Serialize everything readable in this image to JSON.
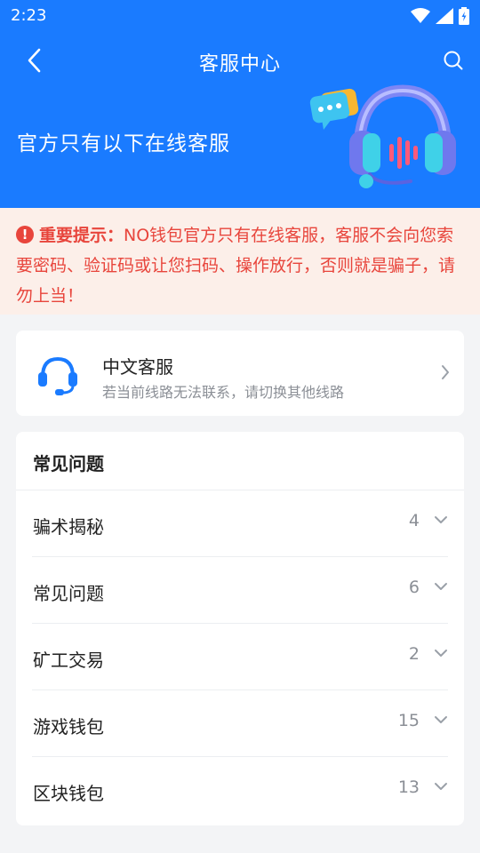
{
  "status_bar": {
    "time": "2:23"
  },
  "nav": {
    "title": "客服中心"
  },
  "hero": {
    "text": "官方只有以下在线客服"
  },
  "notice": {
    "label": "重要提示：",
    "text": "NO钱包官方只有在线客服，客服不会向您索要密码、验证码或让您扫码、操作放行，否则就是骗子，请勿上当！"
  },
  "cs": {
    "title": "中文客服",
    "subtitle": "若当前线路无法联系，请切换其他线路"
  },
  "faq": {
    "title": "常见问题",
    "items": [
      {
        "label": "骗术揭秘",
        "count": "4"
      },
      {
        "label": "常见问题",
        "count": "6"
      },
      {
        "label": "矿工交易",
        "count": "2"
      },
      {
        "label": "游戏钱包",
        "count": "15"
      },
      {
        "label": "区块钱包",
        "count": "13"
      }
    ]
  },
  "colors": {
    "primary": "#1a7bff",
    "warning": "#e8453c",
    "notice_bg": "#fcefe9",
    "page_bg": "#f3f4f6"
  }
}
